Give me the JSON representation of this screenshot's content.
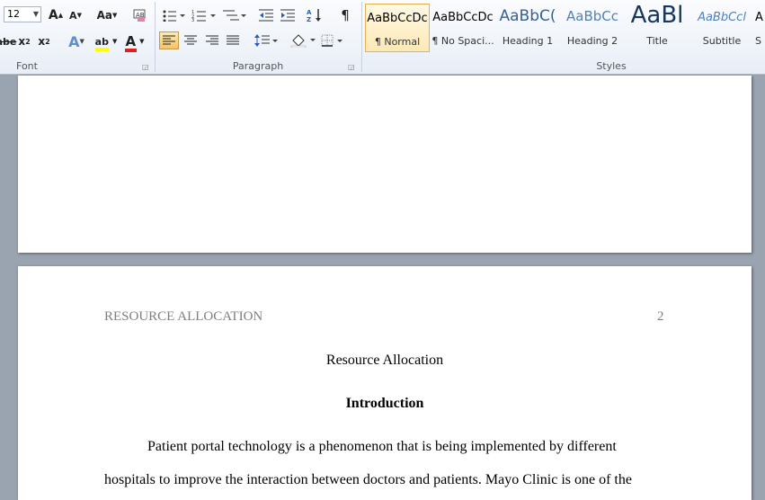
{
  "ribbon": {
    "font": {
      "label": "Font",
      "font_size": "12",
      "grow_font": "A",
      "shrink_font": "A",
      "change_case": "Aa",
      "strikethrough": "abe",
      "subscript": "x",
      "superscript": "x",
      "text_effects": "A",
      "highlight": "ab",
      "font_color": "A"
    },
    "paragraph": {
      "label": "Paragraph"
    },
    "styles": {
      "label": "Styles",
      "items": [
        {
          "sample": "AaBbCcDc",
          "name": "¶ Normal",
          "color": "#000000"
        },
        {
          "sample": "AaBbCcDc",
          "name": "¶ No Spaci...",
          "color": "#000000"
        },
        {
          "sample": "AaBbC(",
          "name": "Heading 1",
          "color": "#376092"
        },
        {
          "sample": "AaBbCc",
          "name": "Heading 2",
          "color": "#4f81bd"
        },
        {
          "sample": "AaBl",
          "name": "Title",
          "color": "#17365d"
        },
        {
          "sample": "AaBbCcl",
          "name": "Subtitle",
          "color": "#4f81bd"
        },
        {
          "sample": "A",
          "name": "S",
          "color": "#000000"
        }
      ]
    }
  },
  "document": {
    "page2": {
      "running_head": "RESOURCE ALLOCATION",
      "page_number": "2",
      "title": "Resource Allocation",
      "heading": "Introduction",
      "line1": "Patient portal technology is a phenomenon that is being implemented by different",
      "line2": "hospitals to improve the interaction between doctors and patients. Mayo Clinic is one of the"
    }
  },
  "colors": {
    "accent_highlight": "#ffff00",
    "font_color_bar": "#e02020",
    "active_style_border": "#e7b04e"
  }
}
